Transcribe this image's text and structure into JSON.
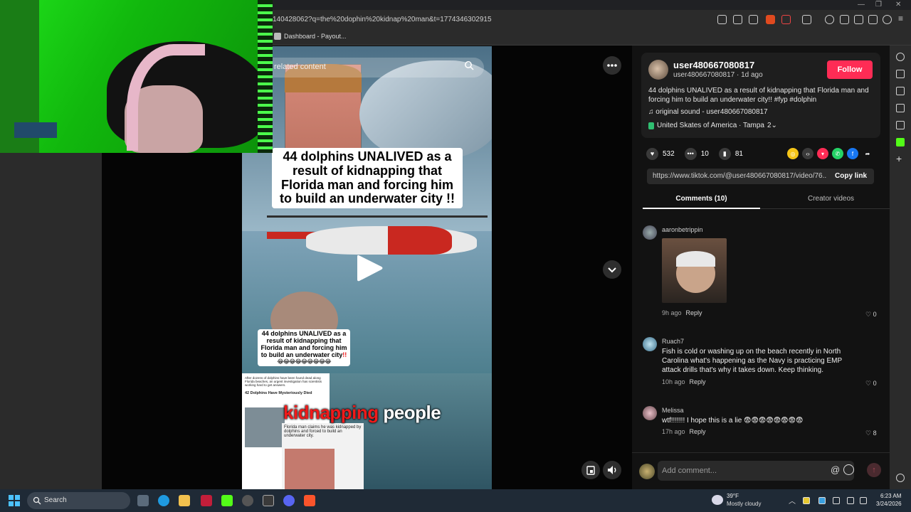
{
  "browser": {
    "url": "140428062?q=the%20dophin%20kidnap%20man&t=1774346302915",
    "bookmark_label": "Dashboard - Payout..."
  },
  "video": {
    "related_label": "related content",
    "title_big": "44 dolphins UNALIVED as a result of kidnapping that Florida man and forcing him to build an underwater city !!",
    "title_small": "44 dolphins UNALIVED as a result of kidnapping that Florida man and forcing him to build an underwater city",
    "title_small_bang": "!!",
    "title_small_emojis": "😂😂😂😂😂😂😂😂😂",
    "caption_red": "kidnapping",
    "caption_white": "people",
    "article1_text": "After dozens of dolphins have been found dead along Florida beaches, an urgent investigation has scientists working hard to get answers.",
    "article1_headline": "42 Dolphins Have Mysteriously Died",
    "article2_text": "Florida man claims he was kidnapped by dolphins and forced to build an underwater city."
  },
  "post": {
    "username": "user480667080817",
    "subline": "user480667080817 · 1d ago",
    "follow_label": "Follow",
    "description": "44 dolphins UNALIVED as a result of kidnapping that Florida man and forcing him to build an underwater city!! #fyp #dolphin",
    "sound": "♫  original sound - user480667080817",
    "location": "United Skates of America · Tampa",
    "location_badge": "2⌄",
    "likes": "532",
    "comments_count": "10",
    "saves": "81",
    "link_url": "https://www.tiktok.com/@user480667080817/video/76...",
    "copy_link_label": "Copy link"
  },
  "tabs": {
    "comments": "Comments (10)",
    "creator": "Creator videos"
  },
  "comments": [
    {
      "name": "aaronbetrippin",
      "text": "",
      "time": "9h ago",
      "reply": "Reply",
      "likes": "♡ 0"
    },
    {
      "name": "Ruach7",
      "text": "Fish is cold or washing up on the beach recently in North Carolina what's happening as the Navy is practicing EMP attack drills that's why it takes down. Keep thinking.",
      "time": "10h ago",
      "reply": "Reply",
      "likes": "♡ 0"
    },
    {
      "name": "Melissa",
      "text": "wtf!!!!!!! I hope this is a lie 😨😨😨😨😨😨😨😨",
      "time": "17h ago",
      "reply": "Reply",
      "likes": "♡ 8"
    }
  ],
  "add_comment": {
    "placeholder": "Add comment...",
    "at": "@",
    "post": "↑"
  },
  "taskbar": {
    "search_label": "Search",
    "weather_temp": "39°F",
    "weather_desc": "Mostly cloudy",
    "time": "6:23 AM",
    "date": "3/24/2026"
  },
  "icons": {
    "play": "play-icon",
    "more": "more-icon",
    "chevron": "chevron-down-icon",
    "volume": "volume-icon",
    "accent": "#fe2c55"
  }
}
